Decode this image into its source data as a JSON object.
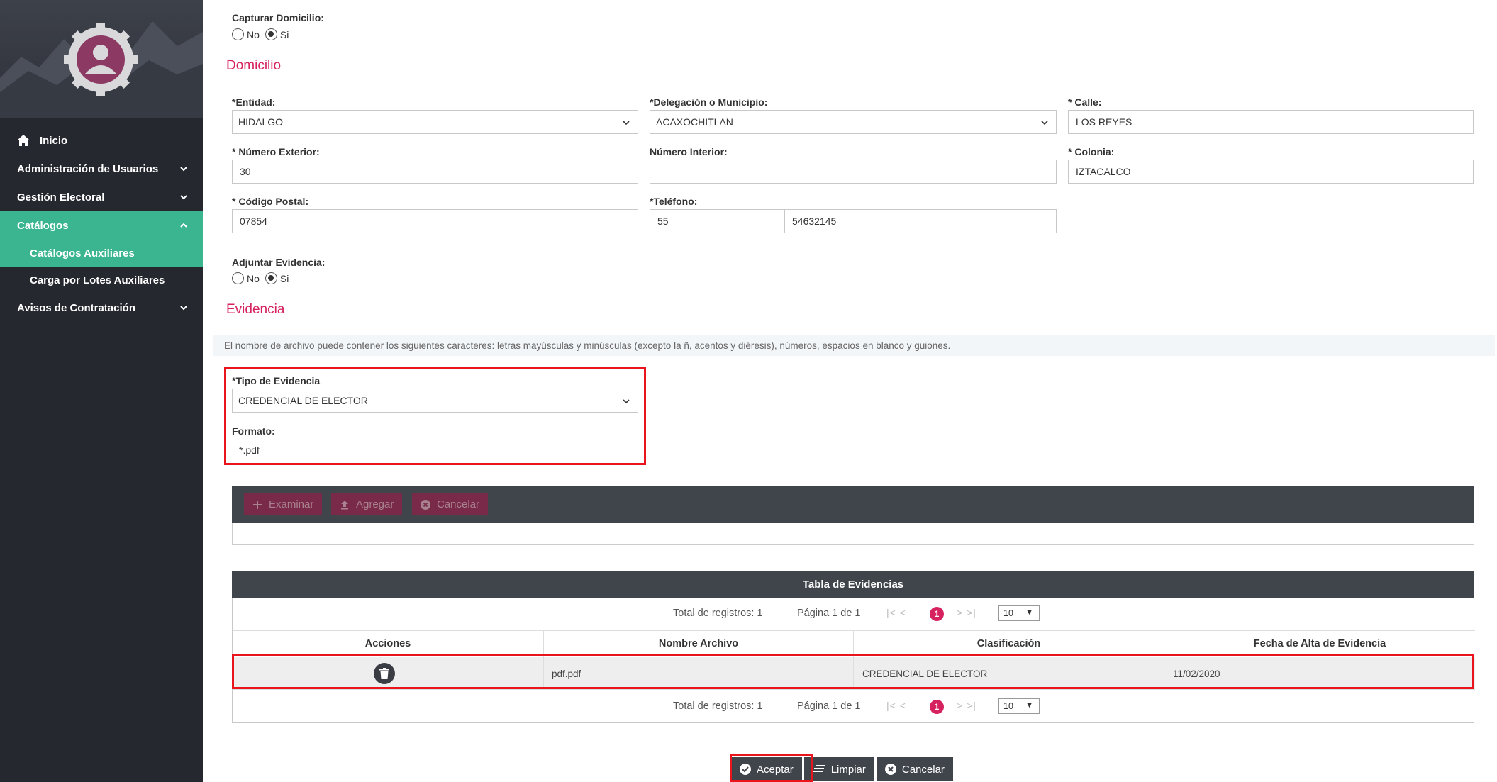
{
  "sidebar": {
    "items": [
      {
        "label": "Inicio"
      },
      {
        "label": "Administración de Usuarios"
      },
      {
        "label": "Gestión Electoral"
      },
      {
        "label": "Catálogos"
      },
      {
        "label": "Catálogos Auxiliares"
      },
      {
        "label": "Carga por Lotes Auxiliares"
      },
      {
        "label": "Avisos de Contratación"
      }
    ]
  },
  "form": {
    "capturar_domicilio": {
      "label": "Capturar Domicilio:",
      "opt_no": "No",
      "opt_si": "Si",
      "selected": "Si"
    },
    "domicilio_title": "Domicilio",
    "entidad": {
      "label": "*Entidad:",
      "value": "HIDALGO"
    },
    "delegacion": {
      "label": "*Delegación o Municipio:",
      "value": "ACAXOCHITLAN"
    },
    "calle": {
      "label": "* Calle:",
      "value": "LOS REYES"
    },
    "num_ext": {
      "label": "* Número Exterior:",
      "value": "30"
    },
    "num_int": {
      "label": "Número Interior:",
      "value": ""
    },
    "colonia": {
      "label": "* Colonia:",
      "value": "IZTACALCO"
    },
    "cp": {
      "label": "* Código Postal:",
      "value": "07854"
    },
    "telefono": {
      "label": "*Teléfono:",
      "lada": "55",
      "numero": "54632145"
    },
    "adjuntar": {
      "label": "Adjuntar Evidencia:",
      "opt_no": "No",
      "opt_si": "Si",
      "selected": "Si"
    },
    "evidencia_title": "Evidencia",
    "info": "El nombre de archivo puede contener los siguientes caracteres: letras mayúsculas y minúsculas (excepto la ñ, acentos y diéresis), números, espacios en blanco y guiones.",
    "tipo_evidencia": {
      "label": "*Tipo de Evidencia",
      "value": "CREDENCIAL DE ELECTOR"
    },
    "formato": {
      "label": "Formato:",
      "value": "*.pdf"
    }
  },
  "upload": {
    "examinar": "Examinar",
    "agregar": "Agregar",
    "cancelar": "Cancelar"
  },
  "table": {
    "title": "Tabla de Evidencias",
    "total": "Total de registros: 1",
    "pagina": "Página 1 de 1",
    "current_page": "1",
    "page_size": "10",
    "columns": [
      "Acciones",
      "Nombre Archivo",
      "Clasificación",
      "Fecha de Alta de Evidencia"
    ],
    "rows": [
      {
        "nombre": "pdf.pdf",
        "clasificacion": "CREDENCIAL DE ELECTOR",
        "fecha": "11/02/2020"
      }
    ]
  },
  "actions": {
    "aceptar": "Aceptar",
    "limpiar": "Limpiar",
    "cancelar": "Cancelar"
  },
  "colors": {
    "accent": "#d6225f",
    "sidebar": "#25282f",
    "active": "#3bb58f",
    "highlight": "#e8161c"
  }
}
